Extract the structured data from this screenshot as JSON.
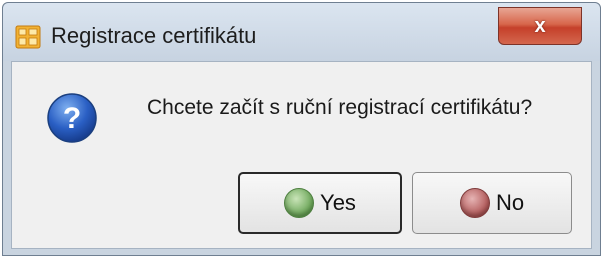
{
  "window": {
    "title": "Registrace certifikátu",
    "close_label": "x"
  },
  "dialog": {
    "message": "Chcete začít s ruční registrací certifikátu?",
    "icon": "question-icon"
  },
  "buttons": {
    "yes_label": "Yes",
    "no_label": "No"
  },
  "colors": {
    "accent_yes": "#6da75a",
    "accent_no": "#b25b5b",
    "close_red": "#c5402a"
  }
}
